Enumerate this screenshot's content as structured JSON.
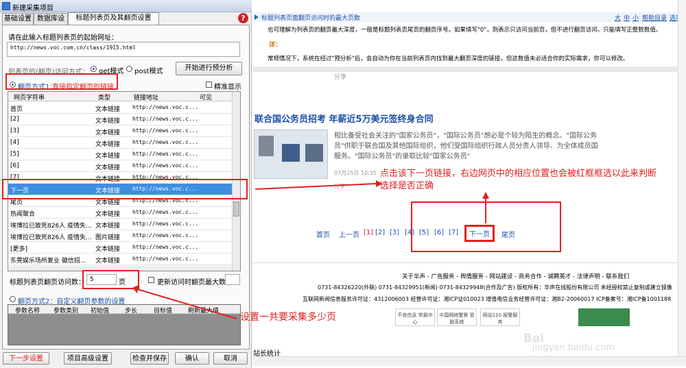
{
  "window": {
    "title": "新建采集项目"
  },
  "tabs": [
    "基础设置",
    "数据库设置",
    "标题列表页及其翻页设置"
  ],
  "help_icon": "?",
  "form": {
    "start_url_label": "请在此输入标题列表页的起始网址：",
    "start_url": "http://news.voc.com.cn/class/1915.html",
    "method_label": "列表页的(翻页)访问方式：",
    "get_label": "get模式",
    "post_label": "post模式",
    "analyze_button": "开始进行预分析",
    "mode1_label": "翻页方式1：",
    "mode1_desc": "直接指定翻页的链接",
    "precise_label": "精准显示",
    "columns": [
      "网页字符串",
      "类型",
      "链接地址",
      "可见"
    ],
    "rows": [
      {
        "text": "首页",
        "type": "文本链接",
        "url": "http://news.voc.c..."
      },
      {
        "text": "[2]",
        "type": "文本链接",
        "url": "http://news.voc.c..."
      },
      {
        "text": "[3]",
        "type": "文本链接",
        "url": "http://news.voc.c..."
      },
      {
        "text": "[4]",
        "type": "文本链接",
        "url": "http://news.voc.c..."
      },
      {
        "text": "[5]",
        "type": "文本链接",
        "url": "http://news.voc.c..."
      },
      {
        "text": "[6]",
        "type": "文本链接",
        "url": "http://news.voc.c..."
      },
      {
        "text": "[7]",
        "type": "文本链接",
        "url": "http://news.voc.c..."
      },
      {
        "text": "下一页",
        "type": "文本链接",
        "url": "http://news.voc.c..."
      },
      {
        "text": "尾页",
        "type": "文本链接",
        "url": "http://news.voc.c..."
      },
      {
        "text": "热闻聚合",
        "type": "文本链接",
        "url": "http://news.voc.c..."
      },
      {
        "text": "埃博拉已致死826人 疫情失...",
        "type": "文本链接",
        "url": "http://news.voc.c..."
      },
      {
        "text": "埃博拉已致死826人 疫情失...",
        "type": "图片链接",
        "url": "http://news.voc.c..."
      },
      {
        "text": "[更多]",
        "type": "文本链接",
        "url": "http://news.voc.c..."
      },
      {
        "text": "东莞娱乐场所复业 徽信招...",
        "type": "文本链接",
        "url": "http://news.voc.c..."
      },
      {
        "text": "东莞娱乐场所复业 徽信招...",
        "type": "文本链接",
        "url": "http://news.voc.c..."
      }
    ],
    "selected_row": 7,
    "page_count_label": "标题列表页翻页访问数：",
    "page_count": "5",
    "page_unit": "页",
    "renew_label": "更新访问时翻页最大数：",
    "mode2_label": "翻页方式2：自定义翻页参数的设置",
    "param_columns": [
      "参数名称",
      "参数类别",
      "初始值",
      "步长",
      "目标值",
      "刷新最大值"
    ],
    "buttons": {
      "prev": "下一步设置>>",
      "advanced": "项目高级设置",
      "check_save": "检查并保存",
      "ok": "确认",
      "cancel": "取消"
    }
  },
  "right": {
    "doc_title": "标题列表页面翻页访问时的最大页数",
    "top_links": [
      "大",
      "中",
      "小",
      "帮助目录",
      "选项"
    ],
    "doc_line1": "也可理解为列表页的翻页最大深度，一般是标题列表页尾页的翻页序号。如果填写\"0\"，则表示只访问当前页，但不进行翻页访问。只能填写正整数数值。",
    "doc_detail": "详：",
    "doc_line2": "常规情况下，系统在经过\"预分析\"后，会自动为你在当前列表页内找到最大翻页深度的链接，但这数值未必适合你的实际需求，你可以修改。",
    "share": "分享",
    "article_title": "联合国公务员招考 年薪近5万美元签终身合同",
    "article_body": "相比备受社会关注的\"国家公务员\"，\"国际公务员\"想必是个较为陌生的概念。\"国际公务员\"供职于联合国及其他国际组织，他们受国际组织行政人员分责人领导、为全体成员国服务。\"国际公务员\"的录取比较\"国家公务员\"",
    "article_date": "07月25日 10:35",
    "annotation1": "点击该下一页链接，右边网页中的相应位置也会被红框框选以此来判断选择是否正确",
    "annotation2": "设置一共要采集多少页",
    "pager": [
      "首页",
      "上一页",
      "[1]",
      "[2]",
      "[3]",
      "[4]",
      "[5]",
      "[6]",
      "[7]",
      "下一页",
      "尾页"
    ],
    "footer_links": "关于华声 - 广告服务 - 舆情服务 - 网站建设 - 商务合作 - 诚聘英才 - 法律声明 - 联系我们",
    "footer_phone": "0731-84326220(外联) 0731-84329951(新闻) 0731-84329948(合作及广告) 版权所有：华声在线股份有限公司 未经授权禁止复制或建立镜像",
    "footer_icp": "互联网新闻信息服务许可证：4312006003 经营许可证：湘ICP证010023 增值电信业务经营许可证：湘B2-20060017 ICP备案号：湘ICP备1001188",
    "logos": [
      "不良信息 举报中心",
      "中国网络警察 管联系统",
      "网站110 报警服务"
    ],
    "stats": "站长统计",
    "watermark": "jingyan.baidu.com",
    "watermark_brand": "Bai"
  },
  "colors": {
    "highlight": "#e02020",
    "selection": "#3d8ee0",
    "link": "#1c4fa8"
  }
}
